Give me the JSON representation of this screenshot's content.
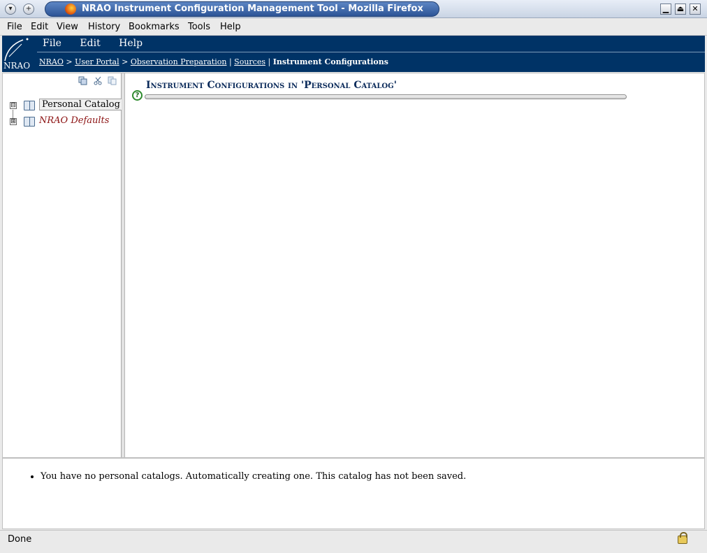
{
  "window": {
    "title": "NRAO Instrument Configuration Management Tool - Mozilla Firefox"
  },
  "browser_menu": [
    "File",
    "Edit",
    "View",
    "History",
    "Bookmarks",
    "Tools",
    "Help"
  ],
  "app": {
    "logo_text": "NRAO",
    "menu": [
      "File",
      "Edit",
      "Help"
    ],
    "breadcrumb": {
      "links": [
        "NRAO",
        "User Portal",
        "Observation Preparation",
        "Sources"
      ],
      "separators": [
        ">",
        ">",
        "|",
        "|"
      ],
      "current": "Instrument Configurations"
    }
  },
  "sidebar": {
    "toolbar_icons": [
      "copy-icon",
      "cut-icon",
      "paste-icon"
    ],
    "tree": [
      {
        "label": "Personal Catalog",
        "expander": "⊟",
        "selected": true
      },
      {
        "label": "NRAO Defaults",
        "expander": "⊞",
        "selected": false
      }
    ]
  },
  "main": {
    "title": "Instrument Configurations in 'Personal Catalog'",
    "help_symbol": "?"
  },
  "messages": [
    "You have no personal catalogs. Automatically creating one. This catalog has not been saved."
  ],
  "status": {
    "text": "Done"
  }
}
